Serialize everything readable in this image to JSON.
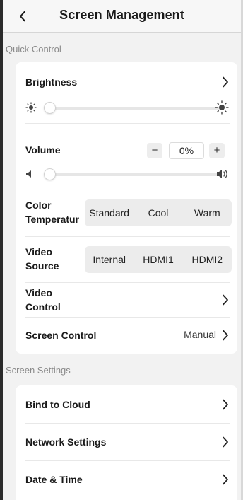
{
  "header": {
    "title": "Screen Management"
  },
  "quick_control": {
    "section_label": "Quick Control",
    "brightness": {
      "label": "Brightness",
      "level_percent": 0
    },
    "volume": {
      "label": "Volume",
      "minus": "−",
      "value": "0%",
      "plus": "+",
      "level_percent": 0
    },
    "color_temperature": {
      "label_line1": "Color",
      "label_line2": "Temperatur",
      "options": [
        "Standard",
        "Cool",
        "Warm"
      ]
    },
    "video_source": {
      "label_line1": "Video",
      "label_line2": "Source",
      "options": [
        "Internal",
        "HDMI1",
        "HDMI2"
      ]
    },
    "video_control": {
      "label_line1": "Video",
      "label_line2": "Control"
    },
    "screen_control": {
      "label": "Screen Control",
      "value": "Manual"
    }
  },
  "screen_settings": {
    "section_label": "Screen Settings",
    "items": [
      {
        "label": "Bind to Cloud"
      },
      {
        "label": "Network Settings"
      },
      {
        "label": "Date & Time"
      }
    ]
  }
}
